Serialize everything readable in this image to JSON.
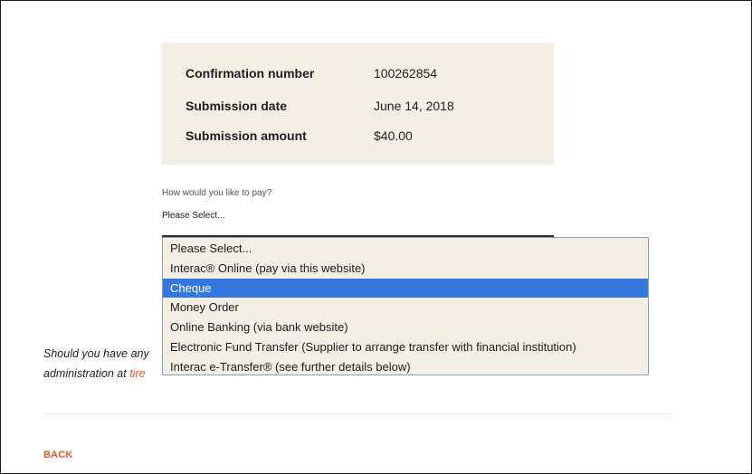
{
  "summary": {
    "rows": [
      {
        "label": "Confirmation number",
        "value": "100262854"
      },
      {
        "label": "Submission date",
        "value": "June 14, 2018"
      },
      {
        "label": "Submission amount",
        "value": "$40.00"
      }
    ]
  },
  "payment": {
    "label": "How would you like to pay?",
    "selected_value": "Please Select...",
    "options": [
      "Please Select...",
      "Interac® Online (pay via this website)",
      "Cheque",
      "Money Order",
      "Online Banking (via bank website)",
      "Electronic Fund Transfer (Supplier to arrange transfer with financial institution)",
      "Interac e-Transfer® (see further details below)"
    ],
    "highlighted_index": 2
  },
  "contact": {
    "line1": "Should you have any",
    "line2_prefix": "administration at ",
    "line2_link": "tire"
  },
  "nav": {
    "back_label": "BACK"
  },
  "colors": {
    "panel": "#f4efe4",
    "accent": "#e0592b",
    "highlight": "#3378e0"
  }
}
